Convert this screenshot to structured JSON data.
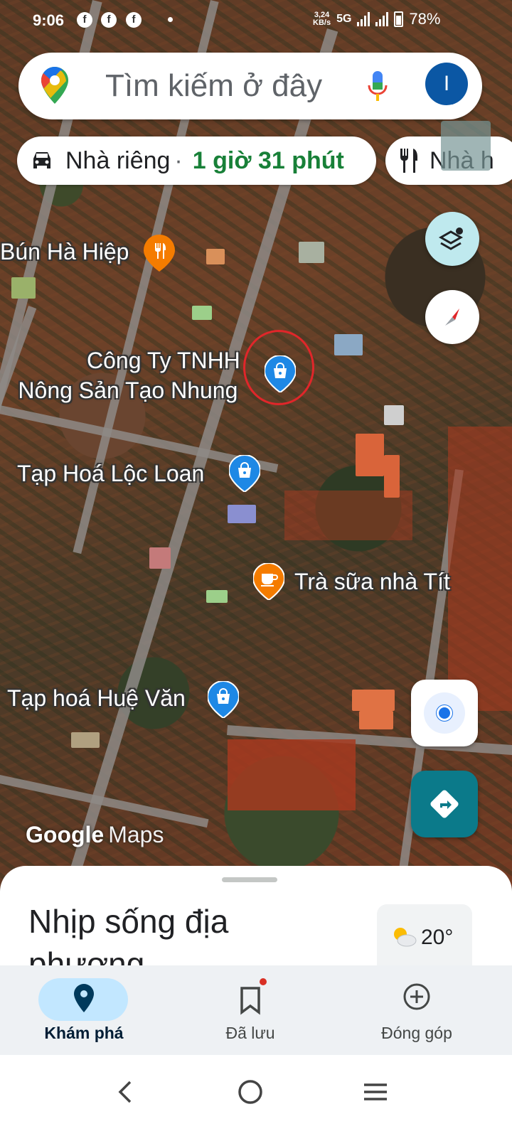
{
  "status_bar": {
    "time": "9:06",
    "net_speed_value": "3,24",
    "net_speed_unit": "KB/s",
    "network": "5G",
    "battery": "78%"
  },
  "search": {
    "placeholder": "Tìm kiếm ở đây",
    "account_initial": "I"
  },
  "chips": {
    "home_label": "Nhà riêng",
    "separator": "·",
    "home_time": "1 giờ 31 phút",
    "food_label": "Nhà h"
  },
  "map": {
    "pois": {
      "bun_ha_hiep": "Bún Hà Hiệp",
      "cong_ty_line1": "Công Ty TNHH",
      "cong_ty_line2": "Nông Sản Tạo Nhung",
      "loc_loan": "Tạp Hoá Lộc Loan",
      "tra_sua": "Trà sữa nhà Tít",
      "hue_van": "Tạp hoá Huệ Văn"
    },
    "watermark_google": "Google",
    "watermark_maps": "Maps"
  },
  "sheet": {
    "title": "Nhịp sống địa phương",
    "temperature": "20°"
  },
  "bottom_nav": {
    "explore": "Khám phá",
    "saved": "Đã lưu",
    "contribute": "Đóng góp"
  },
  "colors": {
    "accent_blue": "#1a73e8",
    "route_green": "#188038",
    "directions_teal": "#0b7a8a",
    "poi_blue": "#1e88e5",
    "poi_orange": "#f57c00",
    "highlight_red": "#e0262a"
  }
}
